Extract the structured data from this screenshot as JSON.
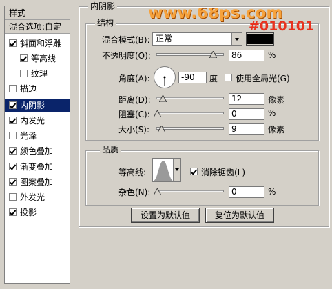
{
  "watermark": "www.68ps.com",
  "annotation_color_code": "#010101",
  "left_panel": {
    "header": "样式",
    "blend_options": "混合选项:自定",
    "items": [
      {
        "label": "斜面和浮雕",
        "checked": true
      },
      {
        "label": "等高线",
        "checked": true
      },
      {
        "label": "纹理",
        "checked": false
      },
      {
        "label": "描边",
        "checked": false
      },
      {
        "label": "内阴影",
        "checked": true,
        "selected": true
      },
      {
        "label": "内发光",
        "checked": true
      },
      {
        "label": "光泽",
        "checked": false
      },
      {
        "label": "颜色叠加",
        "checked": true
      },
      {
        "label": "渐变叠加",
        "checked": true
      },
      {
        "label": "图案叠加",
        "checked": true
      },
      {
        "label": "外发光",
        "checked": false
      },
      {
        "label": "投影",
        "checked": true
      }
    ]
  },
  "panel_title": "内阴影",
  "structure": {
    "title": "结构",
    "blend_mode_label": "混合模式(B):",
    "blend_mode_value": "正常",
    "swatch_color": "#010101",
    "opacity_label": "不透明度(O):",
    "opacity_value": "86",
    "opacity_unit": "%",
    "angle_label": "角度(A):",
    "angle_value": "-90",
    "angle_unit": "度",
    "global_light_label": "使用全局光(G)",
    "global_light_checked": false,
    "distance_label": "距离(D):",
    "distance_value": "12",
    "distance_unit": "像素",
    "choke_label": "阻塞(C):",
    "choke_value": "0",
    "choke_unit": "%",
    "size_label": "大小(S):",
    "size_value": "9",
    "size_unit": "像素"
  },
  "quality": {
    "title": "品质",
    "contour_label": "等高线:",
    "antialias_label": "消除锯齿(L)",
    "antialias_checked": true,
    "noise_label": "杂色(N):",
    "noise_value": "0",
    "noise_unit": "%"
  },
  "buttons": {
    "set_default": "设置为默认值",
    "reset_default": "复位为默认值"
  }
}
